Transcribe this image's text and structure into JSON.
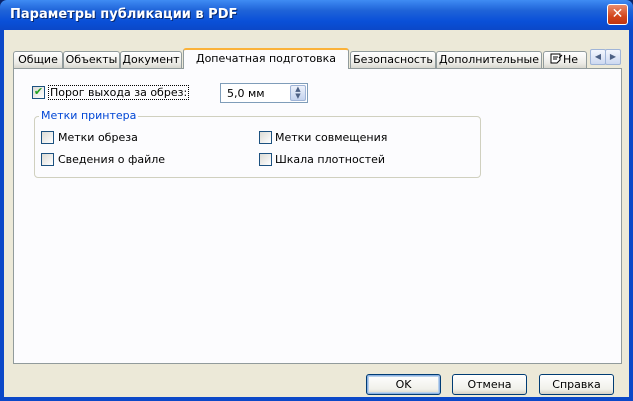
{
  "window": {
    "title": "Параметры публикации в PDF",
    "close_glyph": "✕"
  },
  "tabs": [
    {
      "label": "Общие"
    },
    {
      "label": "Объекты"
    },
    {
      "label": "Документ"
    },
    {
      "label": "Допечатная подготовка",
      "selected": true
    },
    {
      "label": "Безопасность"
    },
    {
      "label": "Дополнительные"
    },
    {
      "label": "Не",
      "icon": "notes-icon"
    }
  ],
  "tab_scroll": {
    "left": "◀",
    "right": "▶"
  },
  "bleed": {
    "checked": true,
    "label": "Порог выхода за обрез:",
    "value": "5,0 мм",
    "up": "▲",
    "down": "▼"
  },
  "printer_marks": {
    "title": "Метки принтера",
    "items": [
      {
        "label": "Метки обреза",
        "checked": false
      },
      {
        "label": "Метки совмещения",
        "checked": false
      },
      {
        "label": "Сведения о файле",
        "checked": false
      },
      {
        "label": "Шкала плотностей",
        "checked": false
      }
    ]
  },
  "buttons": {
    "ok": "OK",
    "cancel": "Отмена",
    "help": "Справка"
  },
  "colors": {
    "titlebar": "#0a50d8",
    "active_tab_accent": "#fbb239",
    "group_title": "#0046d5"
  }
}
